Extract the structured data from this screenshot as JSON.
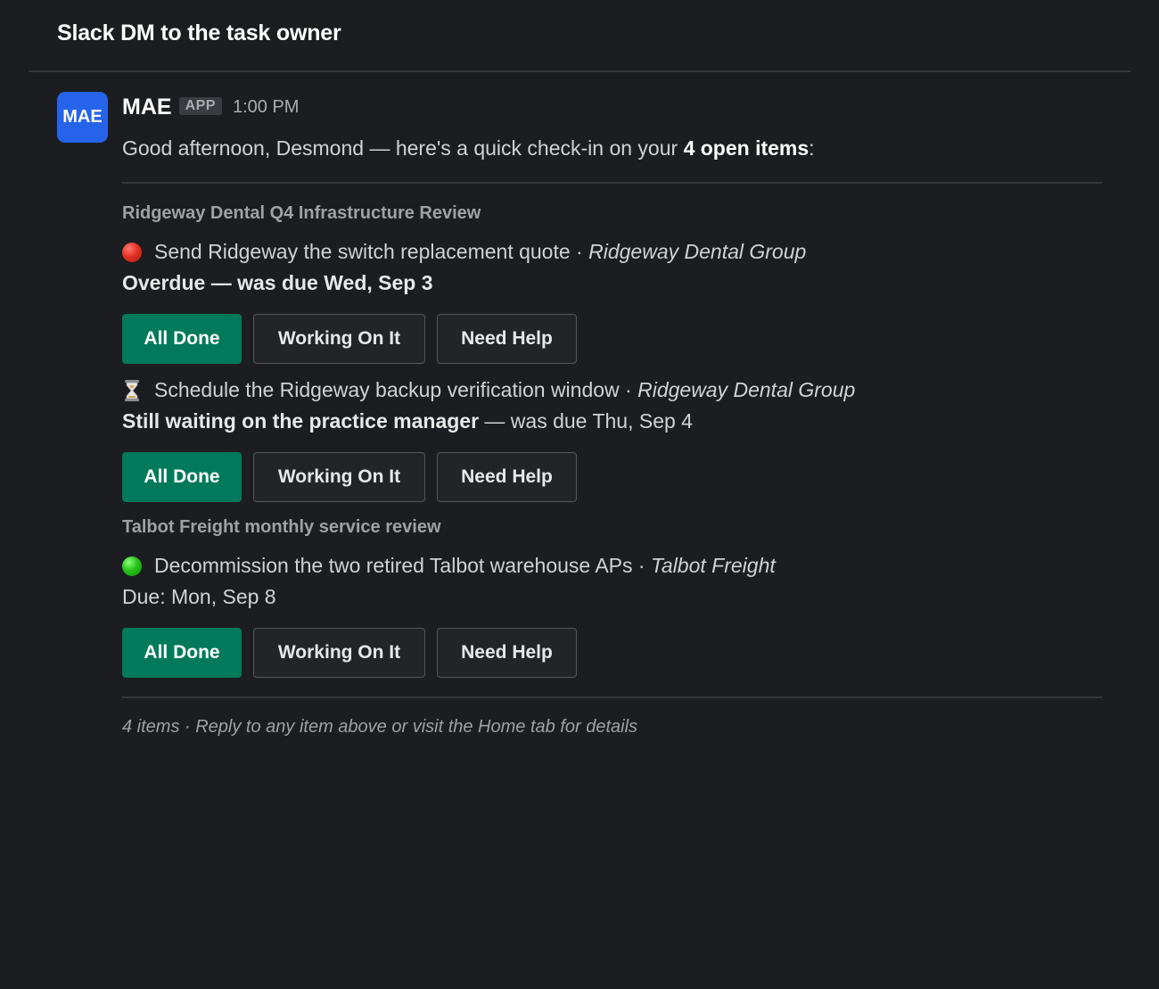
{
  "header": {
    "title": "Slack DM to the task owner"
  },
  "message": {
    "avatar_text": "MAE",
    "sender": "MAE",
    "badge": "APP",
    "time": "1:00 PM",
    "greeting_prefix": "Good afternoon, Desmond — here's a quick check-in on your ",
    "greeting_bold": "4 open items",
    "greeting_suffix": ":"
  },
  "sections": [
    {
      "title": "Ridgeway Dental Q4 Infrastructure Review",
      "tasks": [
        {
          "status_icon": "red-circle-icon",
          "text": "Send Ridgeway the switch replacement quote",
          "separator": " · ",
          "client": "Ridgeway Dental Group",
          "due_bold": "Overdue — was due Wed, Sep 3",
          "due_rest": ""
        },
        {
          "status_icon": "hourglass-icon",
          "text": "Schedule the Ridgeway backup verification window",
          "separator": " · ",
          "client": "Ridgeway Dental Group",
          "due_bold": "Still waiting on the practice manager",
          "due_rest": " — was due Thu, Sep 4"
        }
      ]
    },
    {
      "title": "Talbot Freight monthly service review",
      "tasks": [
        {
          "status_icon": "green-circle-icon",
          "text": "Decommission the two retired Talbot warehouse APs",
          "separator": " · ",
          "client": "Talbot Freight",
          "due_bold": "",
          "due_rest": "Due: Mon, Sep 8"
        }
      ]
    }
  ],
  "buttons": {
    "done": "All Done",
    "working": "Working On It",
    "help": "Need Help"
  },
  "footer": {
    "note": "4 items · Reply to any item above or visit the Home tab for details"
  },
  "colors": {
    "background": "#1b1d21",
    "primary_button": "#007a5a",
    "avatar": "#2563eb"
  }
}
